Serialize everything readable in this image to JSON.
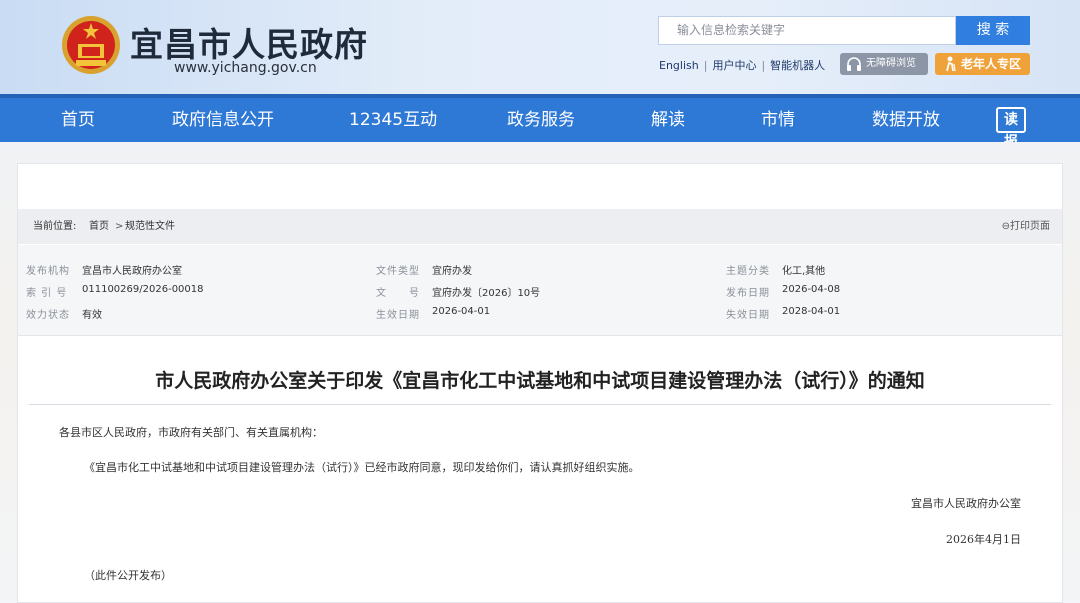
{
  "header": {
    "site_title": "宜昌市人民政府",
    "site_url": "www.yichang.gov.cn",
    "search_placeholder": "输入信息检索关键字",
    "search_button": "搜 索",
    "links": [
      "English",
      "用户中心",
      "智能机器人"
    ],
    "barrier_free": "无障碍浏览",
    "elder_zone": "老年人专区"
  },
  "nav": {
    "items": [
      "首页",
      "政府信息公开",
      "12345互动",
      "政务服务",
      "解读",
      "市情",
      "数据开放"
    ],
    "read_label": "读报"
  },
  "breadcrumb": {
    "label": "当前位置:",
    "home": "首页",
    "sep": ">",
    "current": "规范性文件",
    "print": "打印页面"
  },
  "meta": {
    "publisher_label": "发布机构",
    "publisher": "宜昌市人民政府办公室",
    "index_label": "索 引 号",
    "index": "011100269/2026-00018",
    "status_label": "效力状态",
    "status": "有效",
    "doctype_label": "文件类型",
    "doctype": "宜府办发",
    "docno_label": "文　　号",
    "docno": "宜府办发〔2026〕10号",
    "effective_label": "生效日期",
    "effective": "2026-04-01",
    "topic_label": "主题分类",
    "topic": "化工,其他",
    "pubdate_label": "发布日期",
    "pubdate": "2026-04-08",
    "expire_label": "失效日期",
    "expire": "2028-04-01"
  },
  "document": {
    "title": "市人民政府办公室关于印发《宜昌市化工中试基地和中试项目建设管理办法（试行）》的通知",
    "salutation": "各县市区人民政府，市政府有关部门、有关直属机构：",
    "body": "《宜昌市化工中试基地和中试项目建设管理办法（试行）》已经市政府同意，现印发给你们，请认真抓好组织实施。",
    "signature": "宜昌市人民政府办公室",
    "date": "2026年4月1日",
    "note": "（此件公开发布）"
  }
}
